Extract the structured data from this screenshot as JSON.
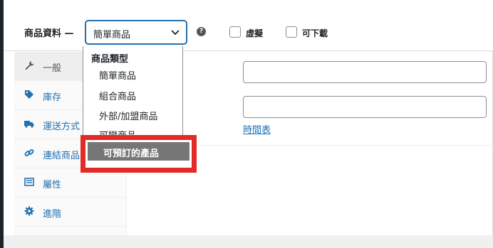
{
  "header": {
    "title": "商品資料 —",
    "product_type": {
      "selected": "簡單商品"
    },
    "virtual_label": "虛擬",
    "downloadable_label": "可下載"
  },
  "tabs": [
    {
      "label": "一般",
      "icon": "wrench-icon",
      "active": true
    },
    {
      "label": "庫存",
      "icon": "tag-icon"
    },
    {
      "label": "運送方式",
      "icon": "truck-icon"
    },
    {
      "label": "連結商品",
      "icon": "link-icon"
    },
    {
      "label": "屬性",
      "icon": "list-icon"
    },
    {
      "label": "進階",
      "icon": "gear-icon"
    }
  ],
  "general": {
    "schedule_link": "時間表"
  },
  "dropdown": {
    "group_label": "商品類型",
    "options": [
      "簡單商品",
      "組合商品",
      "外部/加盟商品",
      "可變商品",
      "可預訂的產品"
    ],
    "highlighted": "可預訂的產品"
  },
  "colors": {
    "accent": "#2271b1",
    "highlight_border": "#e22b27",
    "highlight_bg": "#767676"
  }
}
